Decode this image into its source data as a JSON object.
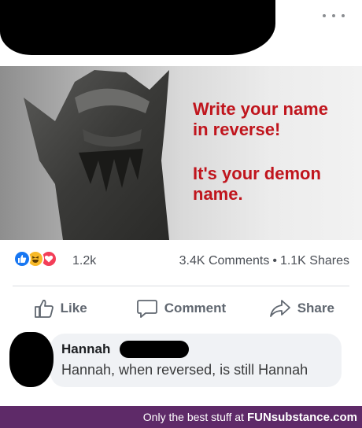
{
  "meme": {
    "line1": "Write your name\nin reverse!",
    "line2": "It's your demon\nname."
  },
  "stats": {
    "reaction_count": "1.2k",
    "comments": "3.4K Comments",
    "separator": "•",
    "shares": "1.1K Shares"
  },
  "actions": {
    "like": "Like",
    "comment": "Comment",
    "share": "Share"
  },
  "comment": {
    "author": "Hannah",
    "text": "Hannah, when reversed, is still Hannah"
  },
  "footer": {
    "tagline": "Only the best stuff at",
    "brand": "FUNsubstance.com"
  },
  "colors": {
    "meme_text": "#c0151d",
    "like_blue": "#1877f2",
    "footer_bg": "#5e2a68"
  }
}
